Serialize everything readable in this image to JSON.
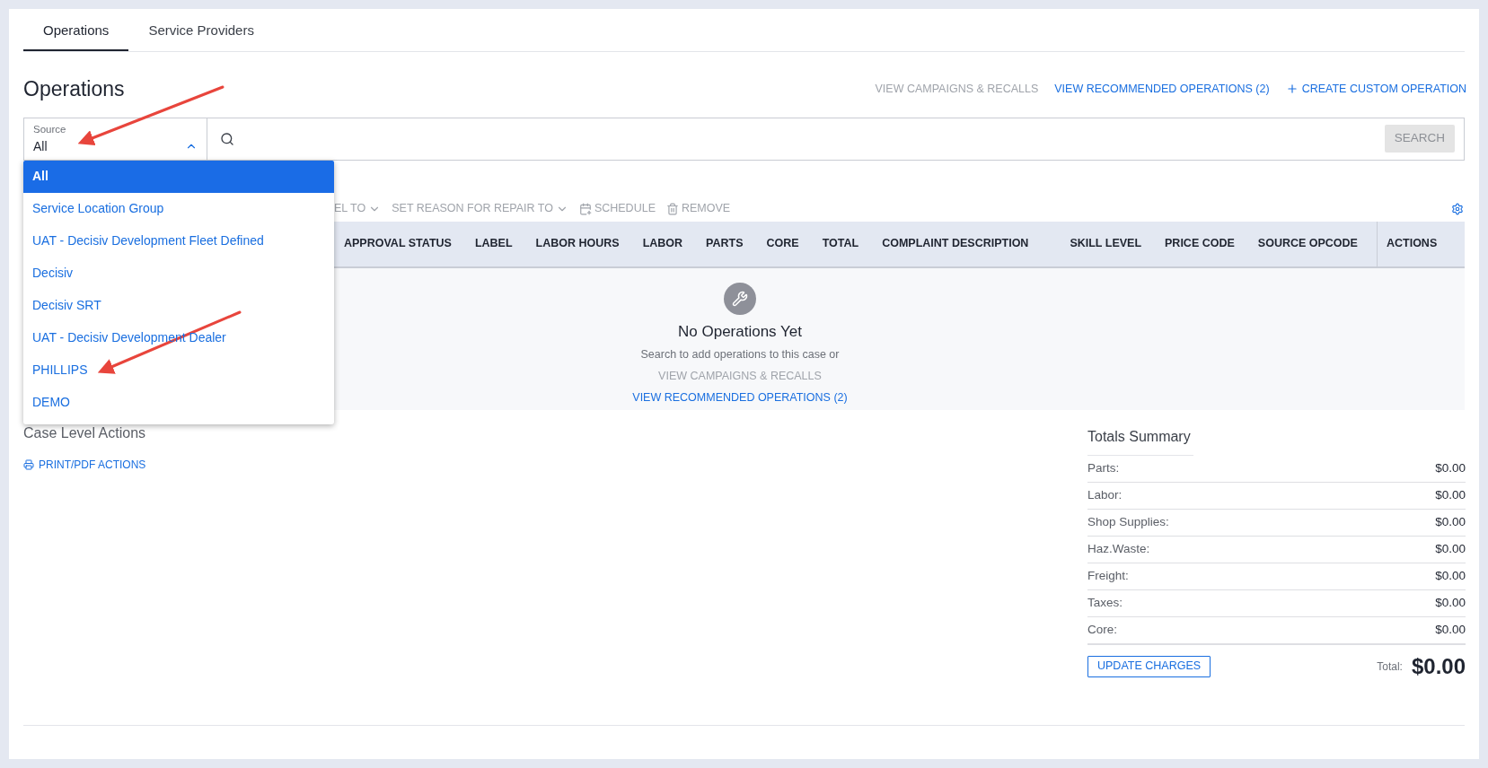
{
  "tabs": [
    {
      "label": "Operations",
      "selected": true
    },
    {
      "label": "Service Providers",
      "selected": false
    }
  ],
  "page_title": "Operations",
  "header_links": [
    {
      "label": "VIEW CAMPAIGNS & RECALLS",
      "kind": "text",
      "disabled": true
    },
    {
      "label": "VIEW RECOMMENDED OPERATIONS (2)",
      "kind": "text",
      "disabled": false
    },
    {
      "label": "CREATE CUSTOM OPERATION",
      "kind": "add",
      "disabled": false
    }
  ],
  "source_select": {
    "label": "Source",
    "value": "All",
    "expanded": true,
    "options": [
      {
        "label": "All",
        "selected": true
      },
      {
        "label": "Service Location Group",
        "selected": false
      },
      {
        "label": "UAT - Decisiv Development Fleet Defined",
        "selected": false
      },
      {
        "label": "Decisiv",
        "selected": false
      },
      {
        "label": "Decisiv SRT",
        "selected": false
      },
      {
        "label": "UAT - Decisiv Development Dealer",
        "selected": false
      },
      {
        "label": "PHILLIPS",
        "selected": false
      },
      {
        "label": "DEMO",
        "selected": false
      }
    ]
  },
  "search": {
    "button": "SEARCH",
    "disabled": true
  },
  "toolbar": [
    {
      "label": "EL TO",
      "kind": "dropdown"
    },
    {
      "label": "SET REASON FOR REPAIR TO",
      "kind": "dropdown"
    },
    {
      "label": "SCHEDULE",
      "kind": "schedule"
    },
    {
      "label": "REMOVE",
      "kind": "remove"
    }
  ],
  "table": {
    "columns": [
      "APPROVAL STATUS",
      "LABEL",
      "LABOR HOURS",
      "LABOR",
      "PARTS",
      "CORE",
      "TOTAL",
      "COMPLAINT DESCRIPTION",
      "SKILL LEVEL",
      "PRICE CODE",
      "SOURCE OPCODE",
      "ACTIONS"
    ]
  },
  "empty_state": {
    "title": "No Operations Yet",
    "text": "Search to add operations to this case or",
    "links": [
      {
        "label": "VIEW CAMPAIGNS & RECALLS",
        "disabled": true
      },
      {
        "label": "VIEW RECOMMENDED OPERATIONS (2)",
        "disabled": false
      }
    ]
  },
  "case_level_actions": {
    "title": "Case Level Actions",
    "actions": [
      {
        "label": "PRINT/PDF ACTIONS"
      }
    ]
  },
  "totals_summary": {
    "title": "Totals Summary",
    "rows": [
      {
        "label": "Parts:",
        "value": "$0.00"
      },
      {
        "label": "Labor:",
        "value": "$0.00"
      },
      {
        "label": "Shop Supplies:",
        "value": "$0.00"
      },
      {
        "label": "Haz.Waste:",
        "value": "$0.00"
      },
      {
        "label": "Freight:",
        "value": "$0.00"
      },
      {
        "label": "Taxes:",
        "value": "$0.00"
      },
      {
        "label": "Core:",
        "value": "$0.00"
      }
    ],
    "button": "UPDATE CHARGES",
    "total_label": "Total:",
    "total_value": "$0.00"
  }
}
